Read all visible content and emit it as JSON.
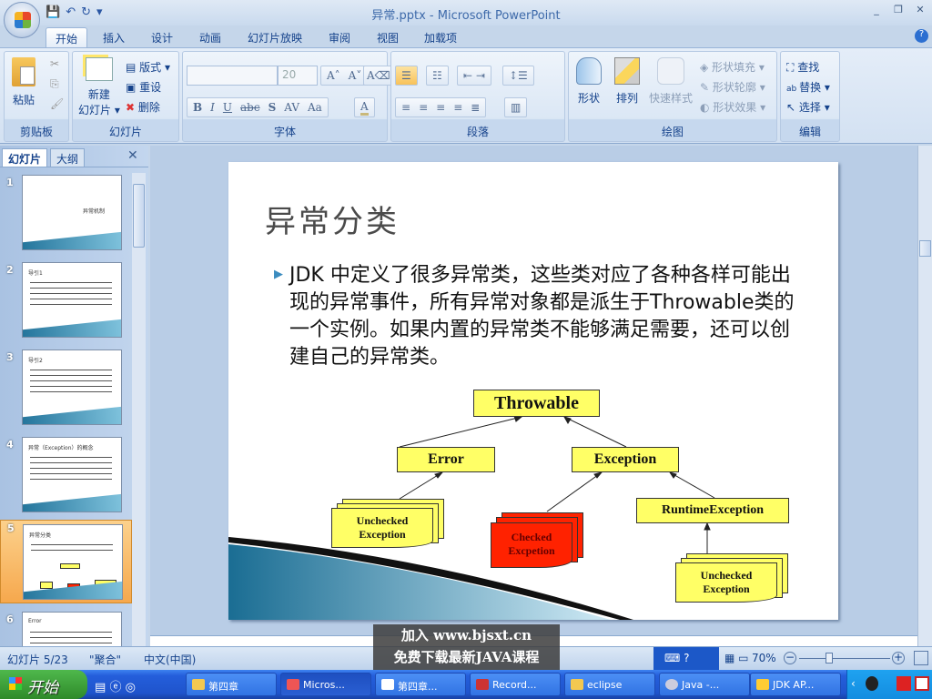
{
  "window": {
    "title": "异常.pptx - Microsoft PowerPoint",
    "minimize": "_",
    "restore": "❐",
    "close": "✕"
  },
  "qat": {
    "save": "💾",
    "undo": "↶",
    "redo": "↻",
    "more": "▾"
  },
  "tabs": [
    "开始",
    "插入",
    "设计",
    "动画",
    "幻灯片放映",
    "审阅",
    "视图",
    "加载项"
  ],
  "help": "?",
  "ribbon": {
    "clipboard": {
      "label": "剪贴板",
      "paste": "粘贴"
    },
    "slides": {
      "label": "幻灯片",
      "new_slide_1": "新建",
      "new_slide_2": "幻灯片 ▾",
      "layout": "版式 ▾",
      "reset": "重设",
      "delete": "删除"
    },
    "font": {
      "label": "字体",
      "font_name": "",
      "font_size": "20",
      "grow": "A˄",
      "shrink": "A˅",
      "clear": "A⌫",
      "bold": "B",
      "italic": "I",
      "underline": "U",
      "strike": "abc",
      "shadow": "S",
      "spacing": "AV",
      "case": "Aa",
      "color": "A"
    },
    "paragraph": {
      "label": "段落"
    },
    "drawing": {
      "label": "绘图",
      "shapes": "形状",
      "arrange": "排列",
      "quick_styles": "快速样式",
      "fill": "形状填充 ▾",
      "outline": "形状轮廓 ▾",
      "effects": "形状效果 ▾"
    },
    "editing": {
      "label": "编辑",
      "find": "查找",
      "replace": "替换 ▾",
      "select": "选择 ▾"
    }
  },
  "panel": {
    "tabs": [
      "幻灯片",
      "大纲"
    ],
    "close": "✕",
    "thumbs": [
      {
        "num": "1",
        "title": "异常机制"
      },
      {
        "num": "2",
        "title": "导引1"
      },
      {
        "num": "3",
        "title": "导引2"
      },
      {
        "num": "4",
        "title": "异常（Exception）的概念"
      },
      {
        "num": "5",
        "title": "异常分类"
      },
      {
        "num": "6",
        "title": "Error"
      }
    ],
    "selected": 5
  },
  "slide": {
    "title": "异常分类",
    "bullet": "JDK 中定义了很多异常类，这些类对应了各种各样可能出现的异常事件，所有异常对象都是派生于Throwable类的一个实例。如果内置的异常类不能够满足需要，还可以创建自己的异常类。",
    "diagram": {
      "throwable": "Throwable",
      "error": "Error",
      "exception": "Exception",
      "runtime": "RuntimeException",
      "unchecked1": "Unchecked Exception",
      "checked": "Checked Excpetion",
      "unchecked2": "Unchecked Exception"
    },
    "colors": {
      "box": "#ffff66",
      "checked": "#ff2200"
    }
  },
  "status": {
    "slide": "幻灯片 5/23",
    "theme": "\"聚合\"",
    "lang": "中文(中国)",
    "zoom": "70%",
    "zoom_level": 0.7
  },
  "watermark": {
    "line1": "加入 www.bjsxt.cn",
    "line2": "免费下载最新JAVA课程"
  },
  "taskbar": {
    "start": "开始",
    "tasks": [
      "第四章",
      "Micros...",
      "第四章...",
      "Record...",
      "eclipse",
      "Java -...",
      "JDK AP..."
    ],
    "active": 1
  }
}
